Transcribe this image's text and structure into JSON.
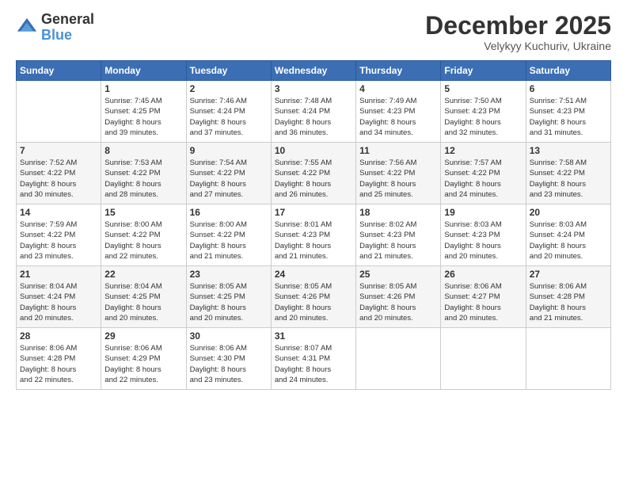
{
  "logo": {
    "general": "General",
    "blue": "Blue"
  },
  "title": "December 2025",
  "location": "Velykyy Kuchuriv, Ukraine",
  "days_header": [
    "Sunday",
    "Monday",
    "Tuesday",
    "Wednesday",
    "Thursday",
    "Friday",
    "Saturday"
  ],
  "weeks": [
    [
      {
        "day": "",
        "sunrise": "",
        "sunset": "",
        "daylight": ""
      },
      {
        "day": "1",
        "sunrise": "Sunrise: 7:45 AM",
        "sunset": "Sunset: 4:25 PM",
        "daylight": "Daylight: 8 hours and 39 minutes."
      },
      {
        "day": "2",
        "sunrise": "Sunrise: 7:46 AM",
        "sunset": "Sunset: 4:24 PM",
        "daylight": "Daylight: 8 hours and 37 minutes."
      },
      {
        "day": "3",
        "sunrise": "Sunrise: 7:48 AM",
        "sunset": "Sunset: 4:24 PM",
        "daylight": "Daylight: 8 hours and 36 minutes."
      },
      {
        "day": "4",
        "sunrise": "Sunrise: 7:49 AM",
        "sunset": "Sunset: 4:23 PM",
        "daylight": "Daylight: 8 hours and 34 minutes."
      },
      {
        "day": "5",
        "sunrise": "Sunrise: 7:50 AM",
        "sunset": "Sunset: 4:23 PM",
        "daylight": "Daylight: 8 hours and 32 minutes."
      },
      {
        "day": "6",
        "sunrise": "Sunrise: 7:51 AM",
        "sunset": "Sunset: 4:23 PM",
        "daylight": "Daylight: 8 hours and 31 minutes."
      }
    ],
    [
      {
        "day": "7",
        "sunrise": "Sunrise: 7:52 AM",
        "sunset": "Sunset: 4:22 PM",
        "daylight": "Daylight: 8 hours and 30 minutes."
      },
      {
        "day": "8",
        "sunrise": "Sunrise: 7:53 AM",
        "sunset": "Sunset: 4:22 PM",
        "daylight": "Daylight: 8 hours and 28 minutes."
      },
      {
        "day": "9",
        "sunrise": "Sunrise: 7:54 AM",
        "sunset": "Sunset: 4:22 PM",
        "daylight": "Daylight: 8 hours and 27 minutes."
      },
      {
        "day": "10",
        "sunrise": "Sunrise: 7:55 AM",
        "sunset": "Sunset: 4:22 PM",
        "daylight": "Daylight: 8 hours and 26 minutes."
      },
      {
        "day": "11",
        "sunrise": "Sunrise: 7:56 AM",
        "sunset": "Sunset: 4:22 PM",
        "daylight": "Daylight: 8 hours and 25 minutes."
      },
      {
        "day": "12",
        "sunrise": "Sunrise: 7:57 AM",
        "sunset": "Sunset: 4:22 PM",
        "daylight": "Daylight: 8 hours and 24 minutes."
      },
      {
        "day": "13",
        "sunrise": "Sunrise: 7:58 AM",
        "sunset": "Sunset: 4:22 PM",
        "daylight": "Daylight: 8 hours and 23 minutes."
      }
    ],
    [
      {
        "day": "14",
        "sunrise": "Sunrise: 7:59 AM",
        "sunset": "Sunset: 4:22 PM",
        "daylight": "Daylight: 8 hours and 23 minutes."
      },
      {
        "day": "15",
        "sunrise": "Sunrise: 8:00 AM",
        "sunset": "Sunset: 4:22 PM",
        "daylight": "Daylight: 8 hours and 22 minutes."
      },
      {
        "day": "16",
        "sunrise": "Sunrise: 8:00 AM",
        "sunset": "Sunset: 4:22 PM",
        "daylight": "Daylight: 8 hours and 21 minutes."
      },
      {
        "day": "17",
        "sunrise": "Sunrise: 8:01 AM",
        "sunset": "Sunset: 4:23 PM",
        "daylight": "Daylight: 8 hours and 21 minutes."
      },
      {
        "day": "18",
        "sunrise": "Sunrise: 8:02 AM",
        "sunset": "Sunset: 4:23 PM",
        "daylight": "Daylight: 8 hours and 21 minutes."
      },
      {
        "day": "19",
        "sunrise": "Sunrise: 8:03 AM",
        "sunset": "Sunset: 4:23 PM",
        "daylight": "Daylight: 8 hours and 20 minutes."
      },
      {
        "day": "20",
        "sunrise": "Sunrise: 8:03 AM",
        "sunset": "Sunset: 4:24 PM",
        "daylight": "Daylight: 8 hours and 20 minutes."
      }
    ],
    [
      {
        "day": "21",
        "sunrise": "Sunrise: 8:04 AM",
        "sunset": "Sunset: 4:24 PM",
        "daylight": "Daylight: 8 hours and 20 minutes."
      },
      {
        "day": "22",
        "sunrise": "Sunrise: 8:04 AM",
        "sunset": "Sunset: 4:25 PM",
        "daylight": "Daylight: 8 hours and 20 minutes."
      },
      {
        "day": "23",
        "sunrise": "Sunrise: 8:05 AM",
        "sunset": "Sunset: 4:25 PM",
        "daylight": "Daylight: 8 hours and 20 minutes."
      },
      {
        "day": "24",
        "sunrise": "Sunrise: 8:05 AM",
        "sunset": "Sunset: 4:26 PM",
        "daylight": "Daylight: 8 hours and 20 minutes."
      },
      {
        "day": "25",
        "sunrise": "Sunrise: 8:05 AM",
        "sunset": "Sunset: 4:26 PM",
        "daylight": "Daylight: 8 hours and 20 minutes."
      },
      {
        "day": "26",
        "sunrise": "Sunrise: 8:06 AM",
        "sunset": "Sunset: 4:27 PM",
        "daylight": "Daylight: 8 hours and 20 minutes."
      },
      {
        "day": "27",
        "sunrise": "Sunrise: 8:06 AM",
        "sunset": "Sunset: 4:28 PM",
        "daylight": "Daylight: 8 hours and 21 minutes."
      }
    ],
    [
      {
        "day": "28",
        "sunrise": "Sunrise: 8:06 AM",
        "sunset": "Sunset: 4:28 PM",
        "daylight": "Daylight: 8 hours and 22 minutes."
      },
      {
        "day": "29",
        "sunrise": "Sunrise: 8:06 AM",
        "sunset": "Sunset: 4:29 PM",
        "daylight": "Daylight: 8 hours and 22 minutes."
      },
      {
        "day": "30",
        "sunrise": "Sunrise: 8:06 AM",
        "sunset": "Sunset: 4:30 PM",
        "daylight": "Daylight: 8 hours and 23 minutes."
      },
      {
        "day": "31",
        "sunrise": "Sunrise: 8:07 AM",
        "sunset": "Sunset: 4:31 PM",
        "daylight": "Daylight: 8 hours and 24 minutes."
      },
      {
        "day": "",
        "sunrise": "",
        "sunset": "",
        "daylight": ""
      },
      {
        "day": "",
        "sunrise": "",
        "sunset": "",
        "daylight": ""
      },
      {
        "day": "",
        "sunrise": "",
        "sunset": "",
        "daylight": ""
      }
    ]
  ]
}
